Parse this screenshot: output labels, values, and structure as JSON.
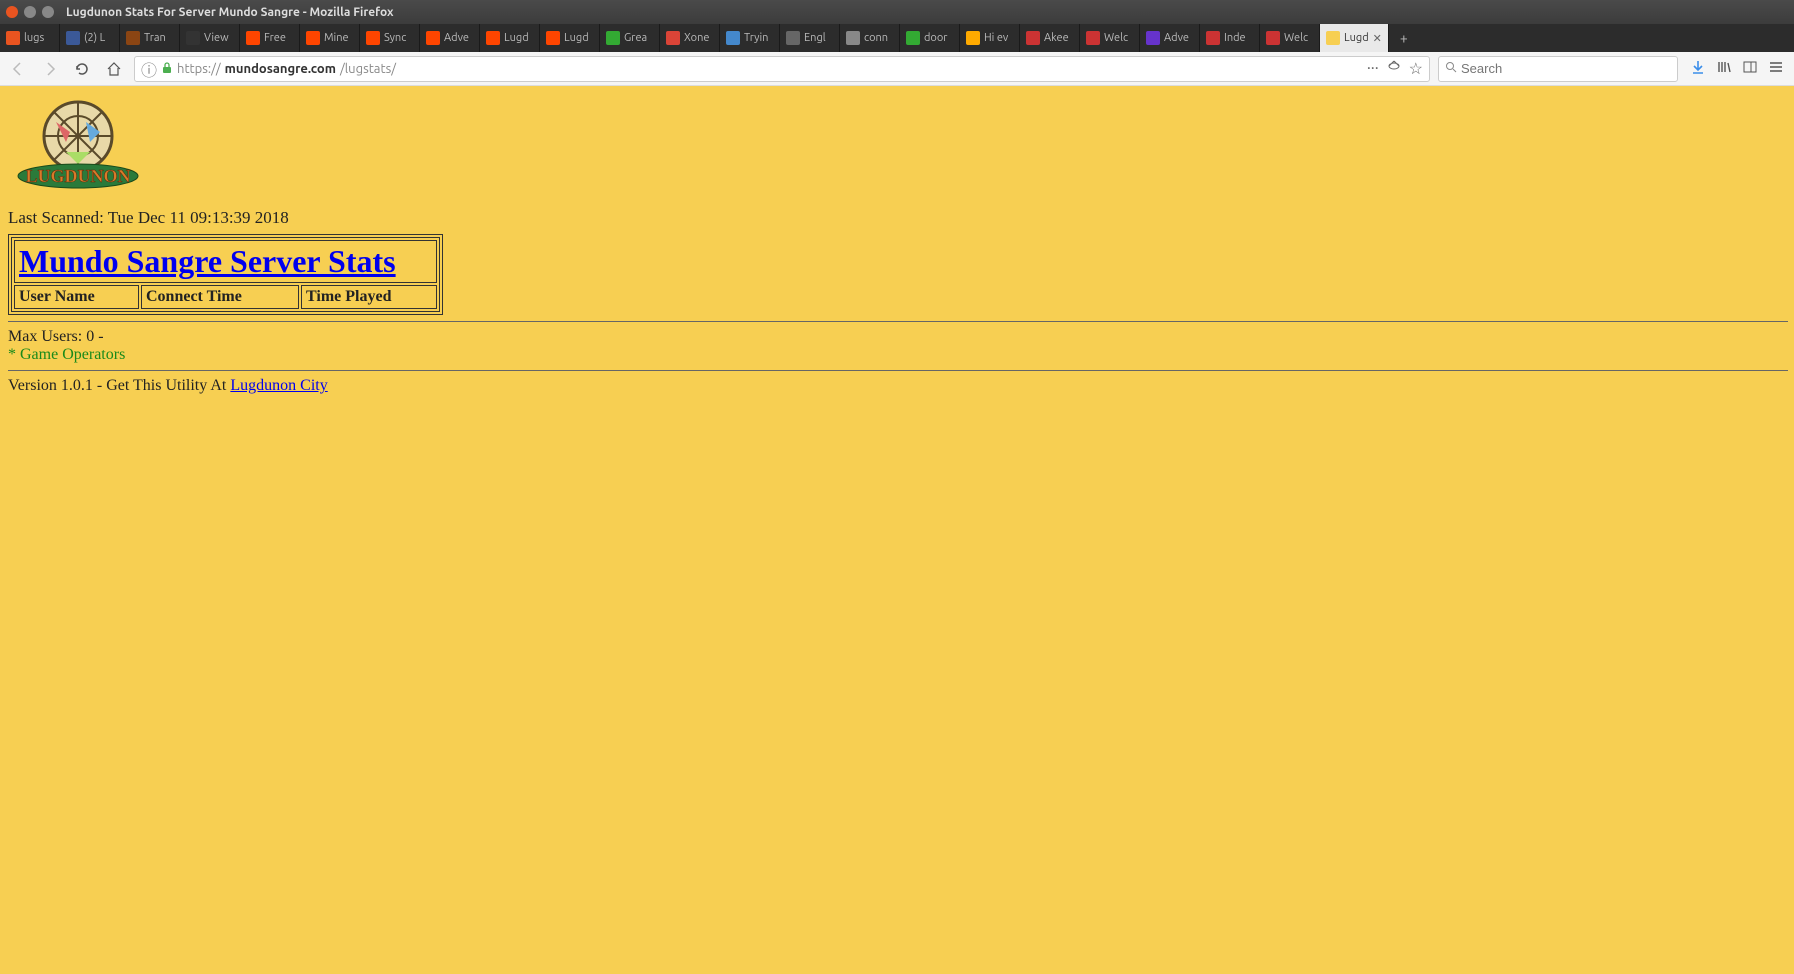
{
  "window": {
    "title": "Lugdunon Stats For Server Mundo Sangre - Mozilla Firefox"
  },
  "tabs": [
    {
      "icon": "#e95420",
      "label": "lugs"
    },
    {
      "icon": "#3b5998",
      "label": "(2) L"
    },
    {
      "icon": "#8b4513",
      "label": "Tran"
    },
    {
      "icon": "#333333",
      "label": "View"
    },
    {
      "icon": "#ff4500",
      "label": "Free"
    },
    {
      "icon": "#ff4500",
      "label": "Mine"
    },
    {
      "icon": "#ff4500",
      "label": "Sync"
    },
    {
      "icon": "#ff4500",
      "label": "Adve"
    },
    {
      "icon": "#ff4500",
      "label": "Lugd"
    },
    {
      "icon": "#ff4500",
      "label": "Lugd"
    },
    {
      "icon": "#33aa33",
      "label": "Grea"
    },
    {
      "icon": "#db4437",
      "label": "Xone"
    },
    {
      "icon": "#4488cc",
      "label": "Tryin"
    },
    {
      "icon": "#666666",
      "label": "Engl"
    },
    {
      "icon": "#888888",
      "label": "conn"
    },
    {
      "icon": "#33aa33",
      "label": "door"
    },
    {
      "icon": "#ffaa00",
      "label": "Hi ev"
    },
    {
      "icon": "#cc3333",
      "label": "Akee"
    },
    {
      "icon": "#cc3333",
      "label": "Welc"
    },
    {
      "icon": "#6633cc",
      "label": "Adve"
    },
    {
      "icon": "#cc3333",
      "label": "Inde"
    },
    {
      "icon": "#cc3333",
      "label": "Welc"
    },
    {
      "icon": "#f7cf52",
      "label": "Lugd",
      "active": true
    }
  ],
  "url": {
    "prefix": "https://",
    "host": "mundosangre.com",
    "path": "/lugstats/"
  },
  "search": {
    "placeholder": "Search"
  },
  "page": {
    "last_scanned": "Last Scanned: Tue Dec 11 09:13:39 2018",
    "stats_title": "Mundo Sangre Server Stats",
    "columns": {
      "user_name": "User Name",
      "connect_time": "Connect Time",
      "time_played": "Time Played"
    },
    "max_users_label": "Max Users: ",
    "max_users_value": "0 -",
    "operators": "* Game Operators",
    "version_prefix": "Version 1.0.1 - Get This Utility At ",
    "version_link": "Lugdunon City"
  }
}
